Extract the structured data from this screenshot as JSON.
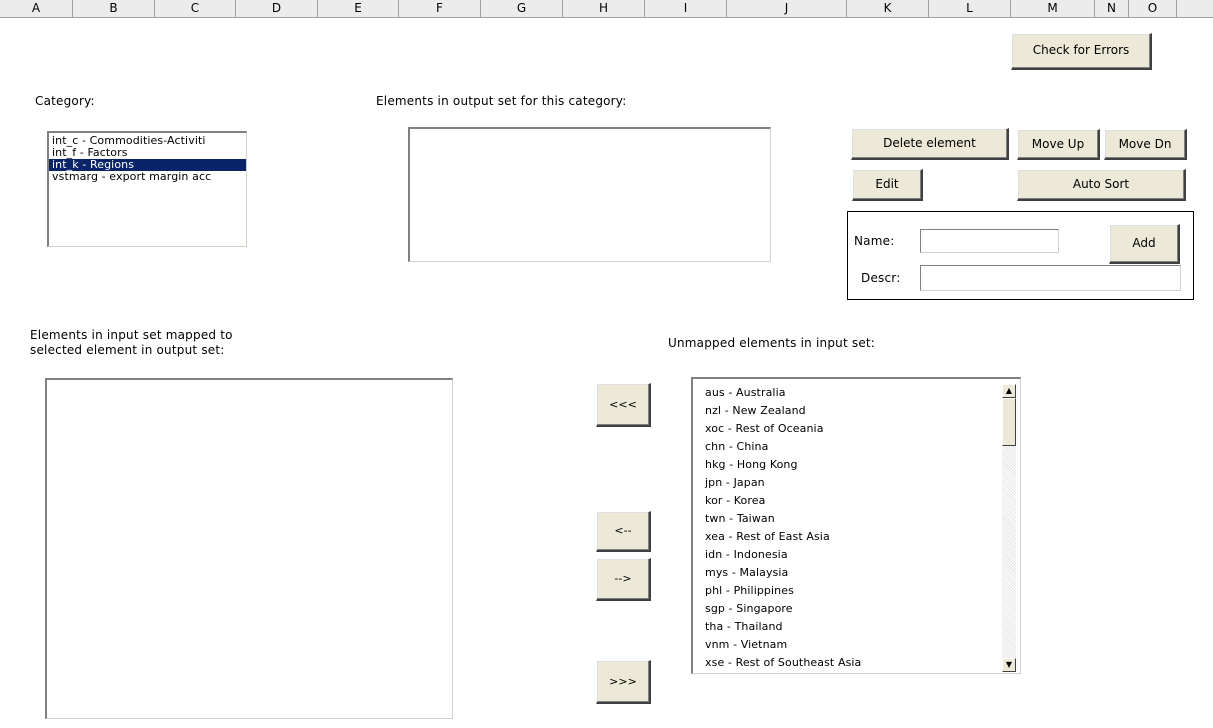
{
  "columns": [
    "A",
    "B",
    "C",
    "D",
    "E",
    "F",
    "G",
    "H",
    "I",
    "J",
    "K",
    "L",
    "M",
    "N",
    "O"
  ],
  "buttons": {
    "check_errors": "Check for Errors",
    "delete_element": "Delete element",
    "move_up": "Move Up",
    "move_down": "Move Dn",
    "edit": "Edit",
    "auto_sort": "Auto Sort",
    "add": "Add",
    "map_all_left": "<<<",
    "map_left": "<--",
    "map_right": "-->",
    "map_all_right": ">>>"
  },
  "labels": {
    "category": "Category:",
    "output_set": "Elements in output set for this category:",
    "mapped_line1": "Elements in input set mapped to",
    "mapped_line2": "selected element in output set:",
    "unmapped": "Unmapped elements in input set:",
    "name": "Name:",
    "descr": "Descr:"
  },
  "inputs": {
    "name_value": "",
    "descr_value": ""
  },
  "category_list": [
    "int_c - Commodities-Activiti",
    "int_f - Factors",
    "int_k - Regions",
    "vstmarg - export margin acc"
  ],
  "category_selected_index": 2,
  "unmapped_list": [
    "aus - Australia",
    "nzl - New Zealand",
    "xoc - Rest of Oceania",
    "chn - China",
    "hkg - Hong Kong",
    "jpn - Japan",
    "kor - Korea",
    "twn - Taiwan",
    "xea - Rest of East Asia",
    "idn - Indonesia",
    "mys - Malaysia",
    "phl - Philippines",
    "sgp - Singapore",
    "tha - Thailand",
    "vnm - Vietnam",
    "xse - Rest of Southeast Asia"
  ],
  "icons": {
    "scroll_up": "▲",
    "scroll_down": "▼"
  },
  "colors": {
    "selection": "#0a246a",
    "button_face": "#ece9d8",
    "header_bg": "#ececec"
  }
}
